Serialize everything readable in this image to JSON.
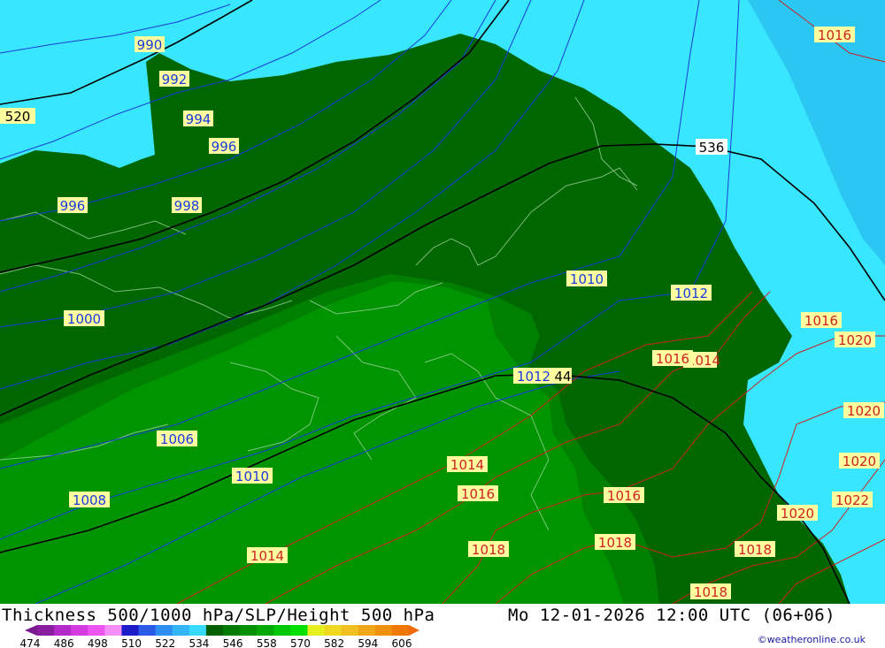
{
  "header": {
    "title": "Thickness 500/1000 hPa/SLP/Height 500 hPa",
    "datetime": "Mo 12-01-2026 12:00 UTC (06+06)",
    "credit": "©weatheronline.co.uk"
  },
  "colors": {
    "sea_light": "#39e6ff",
    "sea_mid": "#2bc6f2",
    "land_dark": "#006600",
    "land_mid": "#007f00",
    "land_bright": "#009500",
    "isobar_blue": "#1a3cdc",
    "isobar_red": "#cc2222",
    "thickness_line": "#000000",
    "label_bg": "#ffffa0"
  },
  "isobar_labels": [
    {
      "text": "990",
      "kind": "blue"
    },
    {
      "text": "992",
      "kind": "blue"
    },
    {
      "text": "994",
      "kind": "blue"
    },
    {
      "text": "996",
      "kind": "blue"
    },
    {
      "text": "996",
      "kind": "blue"
    },
    {
      "text": "998",
      "kind": "blue"
    },
    {
      "text": "1000",
      "kind": "blue"
    },
    {
      "text": "1006",
      "kind": "blue"
    },
    {
      "text": "1008",
      "kind": "blue"
    },
    {
      "text": "1010",
      "kind": "blue"
    },
    {
      "text": "1010",
      "kind": "blue"
    },
    {
      "text": "1012",
      "kind": "blue"
    },
    {
      "text": "1012",
      "kind": "blue"
    },
    {
      "text": "1014",
      "kind": "red"
    },
    {
      "text": "1014",
      "kind": "red"
    },
    {
      "text": "1014",
      "kind": "red"
    },
    {
      "text": "1016",
      "kind": "red"
    },
    {
      "text": "1016",
      "kind": "red"
    },
    {
      "text": "1016",
      "kind": "red"
    },
    {
      "text": "1016",
      "kind": "red"
    },
    {
      "text": "1016",
      "kind": "red"
    },
    {
      "text": "1018",
      "kind": "red"
    },
    {
      "text": "1018",
      "kind": "red"
    },
    {
      "text": "1018",
      "kind": "red"
    },
    {
      "text": "1018",
      "kind": "red"
    },
    {
      "text": "1020",
      "kind": "red"
    },
    {
      "text": "1020",
      "kind": "red"
    },
    {
      "text": "1020",
      "kind": "red"
    },
    {
      "text": "1020",
      "kind": "red"
    },
    {
      "text": "1022",
      "kind": "red"
    }
  ],
  "thickness_labels": [
    {
      "text": "520"
    },
    {
      "text": "536"
    },
    {
      "text": "44"
    }
  ],
  "scale": {
    "ticks": [
      "474",
      "486",
      "498",
      "510",
      "522",
      "534",
      "546",
      "558",
      "570",
      "582",
      "594",
      "606"
    ],
    "colors": [
      "#8a1ea0",
      "#b32bc8",
      "#d43ce0",
      "#ee55f0",
      "#f58ef8",
      "#1c1cc8",
      "#2a5ae6",
      "#2f8ef2",
      "#33b6f8",
      "#36dcff",
      "#006000",
      "#007a00",
      "#009000",
      "#00a800",
      "#00c800",
      "#00e000",
      "#e6f01e",
      "#f0d820",
      "#f0c020",
      "#f0a818",
      "#f09010",
      "#f07808"
    ]
  }
}
